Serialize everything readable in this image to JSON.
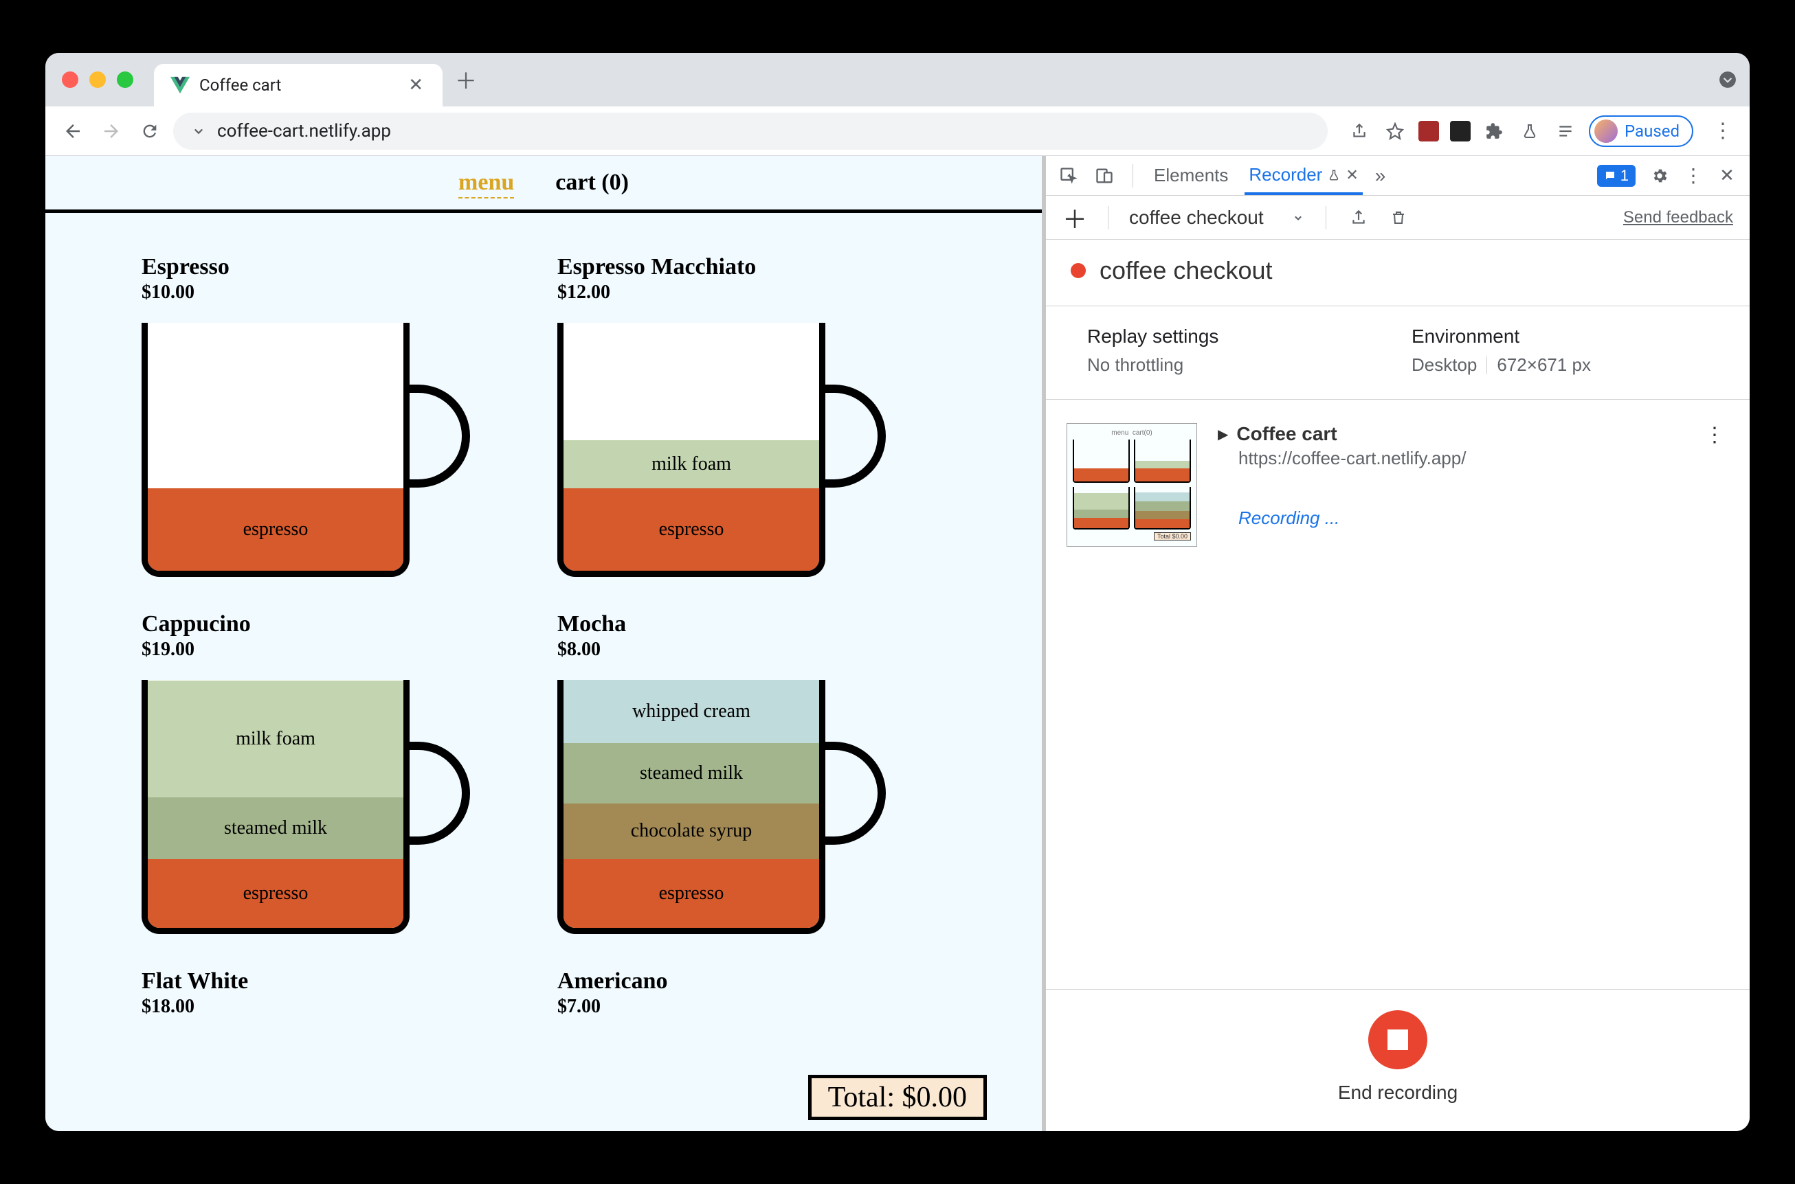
{
  "browser": {
    "tab_title": "Coffee cart",
    "url": "coffee-cart.netlify.app",
    "profile_status": "Paused"
  },
  "app": {
    "nav": {
      "menu": "menu",
      "cart": "cart (0)"
    },
    "products": [
      {
        "name": "Espresso",
        "price": "$10.00"
      },
      {
        "name": "Espresso Macchiato",
        "price": "$12.00"
      },
      {
        "name": "Cappucino",
        "price": "$19.00"
      },
      {
        "name": "Mocha",
        "price": "$8.00"
      },
      {
        "name": "Flat White",
        "price": "$18.00"
      },
      {
        "name": "Americano",
        "price": "$7.00"
      }
    ],
    "layers": {
      "espresso": "espresso",
      "milk_foam": "milk foam",
      "steamed_milk": "steamed milk",
      "whipped_cream": "whipped cream",
      "chocolate_syrup": "chocolate syrup"
    },
    "total_label": "Total: $0.00"
  },
  "devtools": {
    "tabs": {
      "elements": "Elements",
      "recorder": "Recorder"
    },
    "issues_count": "1",
    "toolbar": {
      "recording_name": "coffee checkout",
      "feedback": "Send feedback"
    },
    "title": "coffee checkout",
    "replay": {
      "heading": "Replay settings",
      "value": "No throttling"
    },
    "environment": {
      "heading": "Environment",
      "device": "Desktop",
      "viewport": "672×671 px"
    },
    "step": {
      "title": "Coffee cart",
      "url": "https://coffee-cart.netlify.app/",
      "status": "Recording ..."
    },
    "footer": {
      "label": "End recording"
    }
  }
}
